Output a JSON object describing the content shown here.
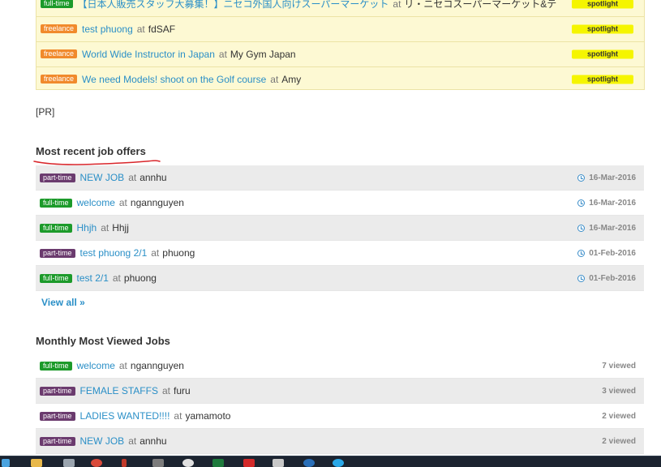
{
  "spotlight": {
    "tag_label": "spotlight",
    "rows": [
      {
        "type": "full-time",
        "title": "【日本人販売スタッフ大募集！】ニセコ外国人向けスーパーマーケット",
        "at": "at",
        "company": "リ・ニセコスーパーマーケット&テ"
      },
      {
        "type": "freelance",
        "title": "test phuong",
        "at": "at",
        "company": "fdSAF"
      },
      {
        "type": "freelance",
        "title": "World Wide Instructor in Japan",
        "at": "at",
        "company": "My Gym Japan"
      },
      {
        "type": "freelance",
        "title": "We need Models! shoot on the Golf course",
        "at": "at",
        "company": "Amy"
      }
    ]
  },
  "pr_text": "[PR]",
  "recent": {
    "heading": "Most recent job offers",
    "view_all": "View all »",
    "rows": [
      {
        "type": "part-time",
        "title": "NEW JOB",
        "at": "at",
        "company": "annhu",
        "date": "16-Mar-2016"
      },
      {
        "type": "full-time",
        "title": "welcome",
        "at": "at",
        "company": "ngannguyen",
        "date": "16-Mar-2016"
      },
      {
        "type": "full-time",
        "title": "Hhjh",
        "at": "at",
        "company": "Hhjj",
        "date": "16-Mar-2016"
      },
      {
        "type": "part-time",
        "title": "test phuong 2/1",
        "at": "at",
        "company": "phuong",
        "date": "01-Feb-2016"
      },
      {
        "type": "full-time",
        "title": "test 2/1",
        "at": "at",
        "company": "phuong",
        "date": "01-Feb-2016"
      }
    ]
  },
  "viewed": {
    "heading": "Monthly Most Viewed Jobs",
    "rows": [
      {
        "type": "full-time",
        "title": "welcome",
        "at": "at",
        "company": "ngannguyen",
        "views": "7",
        "views_label": "viewed"
      },
      {
        "type": "part-time",
        "title": "FEMALE STAFFS",
        "at": "at",
        "company": "furu",
        "views": "3",
        "views_label": "viewed"
      },
      {
        "type": "part-time",
        "title": "LADIES WANTED!!!!",
        "at": "at",
        "company": "yamamoto",
        "views": "2",
        "views_label": "viewed"
      },
      {
        "type": "part-time",
        "title": "NEW JOB",
        "at": "at",
        "company": "annhu",
        "views": "2",
        "views_label": "viewed"
      }
    ]
  },
  "colors": {
    "link": "#2a8fc7",
    "full_time": "#1c9a2a",
    "part_time": "#6b3b6e",
    "freelance": "#f18a2c",
    "spotlight_tag": "#f5f500",
    "spotlight_bg": "#fdf9d3",
    "underline_annotation": "#d9262b"
  },
  "taskbar": {
    "icons": [
      "start-icon",
      "file-explorer-icon",
      "calculator-icon",
      "chrome-icon",
      "app-icon",
      "media-icon",
      "notes-icon",
      "clock-app-icon",
      "excel-icon",
      "flash-icon",
      "editor-icon",
      "browser-icon",
      "skype-icon"
    ]
  }
}
